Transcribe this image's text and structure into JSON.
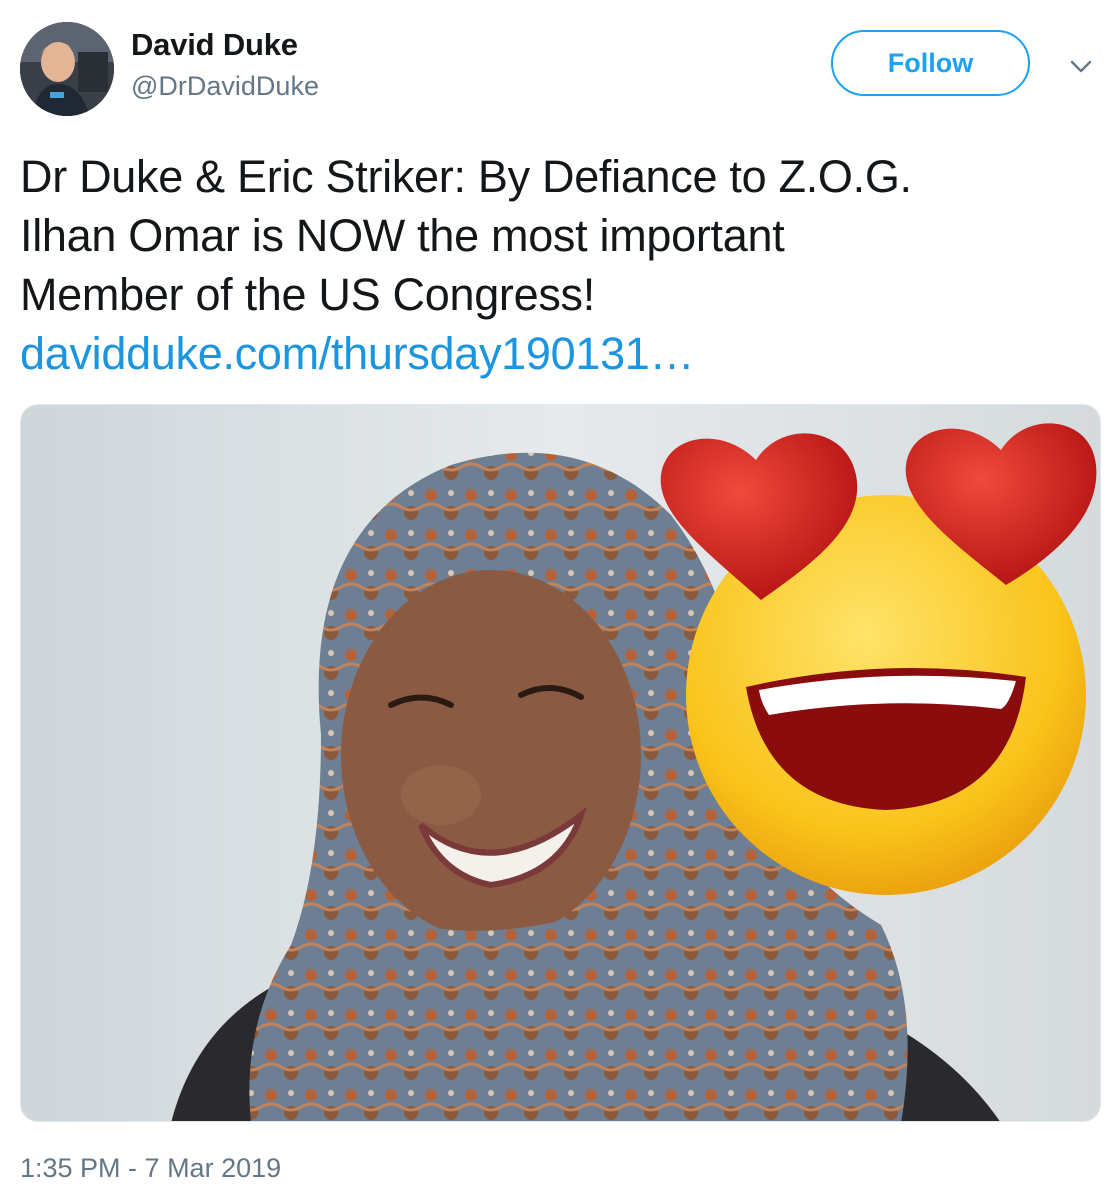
{
  "author": {
    "display_name": "David Duke",
    "handle": "@DrDavidDuke",
    "avatar_icon": "profile-photo"
  },
  "follow_label": "Follow",
  "menu_icon": "chevron-down-icon",
  "tweet": {
    "text_lines": [
      "Dr Duke & Eric Striker: By Defiance to Z.O.G.",
      "Ilhan Omar is NOW the most important",
      "Member of the US Congress!"
    ],
    "link_text": "davidduke.com/thursday190131…"
  },
  "media": {
    "kind": "photo",
    "overlay_icon": "heart-eyes-emoji"
  },
  "timestamp": "1:35 PM - 7 Mar 2019",
  "colors": {
    "accent": "#1da1f2",
    "link": "#1b95e0",
    "text": "#14171a",
    "muted": "#657786"
  }
}
